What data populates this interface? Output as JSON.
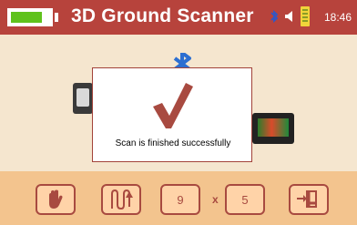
{
  "header": {
    "title": "3D Ground Scanner",
    "time": "18:46",
    "battery_color": "#5fc21d",
    "icons": [
      "battery-icon",
      "bluetooth-icon",
      "speaker-icon",
      "signal-icon"
    ]
  },
  "dialog": {
    "message": "Scan is finished successfully",
    "icon": "checkmark-icon"
  },
  "toolbar": {
    "buttons": [
      {
        "name": "hand-mode-button",
        "icon": "hand-icon"
      },
      {
        "name": "zigzag-mode-button",
        "icon": "zigzag-path-icon"
      },
      {
        "name": "lines-count-field",
        "value": "9"
      },
      {
        "name": "steps-count-field",
        "value": "5"
      },
      {
        "name": "start-corner-button",
        "icon": "corner-arrow-icon"
      }
    ],
    "separator": "x"
  },
  "colors": {
    "header_bg": "#b7433c",
    "main_bg": "#f5e6cf",
    "toolbar_bg": "#f3c48e",
    "accent": "#a84a40"
  }
}
